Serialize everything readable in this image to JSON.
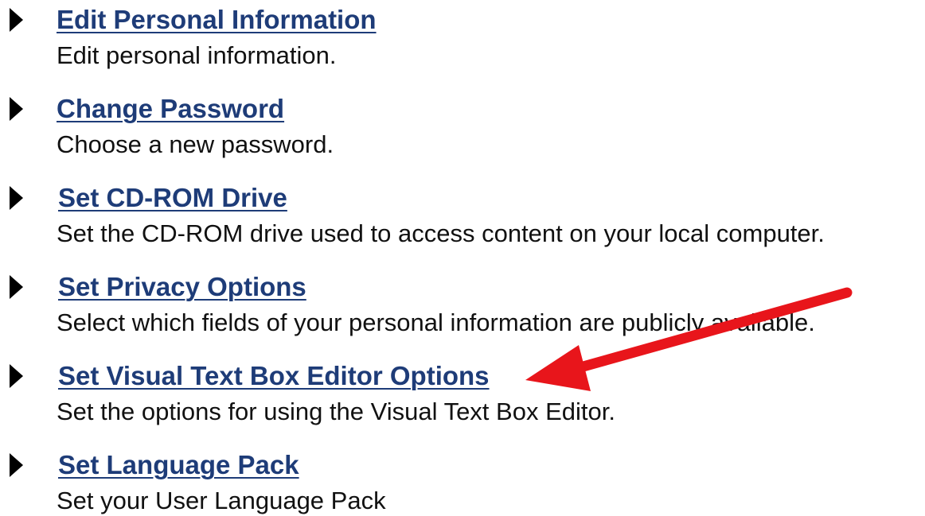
{
  "tools": [
    {
      "title": "Edit Personal Information",
      "description": "Edit personal information."
    },
    {
      "title": "Change Password",
      "description": "Choose a new password."
    },
    {
      "title": "Set CD-ROM Drive",
      "description": "Set the CD-ROM drive used to access content on your local computer."
    },
    {
      "title": "Set Privacy Options",
      "description": "Select which fields of your personal information are publicly available."
    },
    {
      "title": "Set Visual Text Box Editor Options",
      "description": "Set the options for using the Visual Text Box Editor."
    },
    {
      "title": "Set Language Pack",
      "description": "Set your User Language Pack"
    }
  ],
  "colors": {
    "link": "#1e3c78",
    "text": "#111111",
    "bullet": "#000000",
    "annotation_arrow": "#e8151b"
  },
  "icons": {
    "bullet": "triangle-right-icon",
    "annotation": "red-arrow-annotation"
  }
}
